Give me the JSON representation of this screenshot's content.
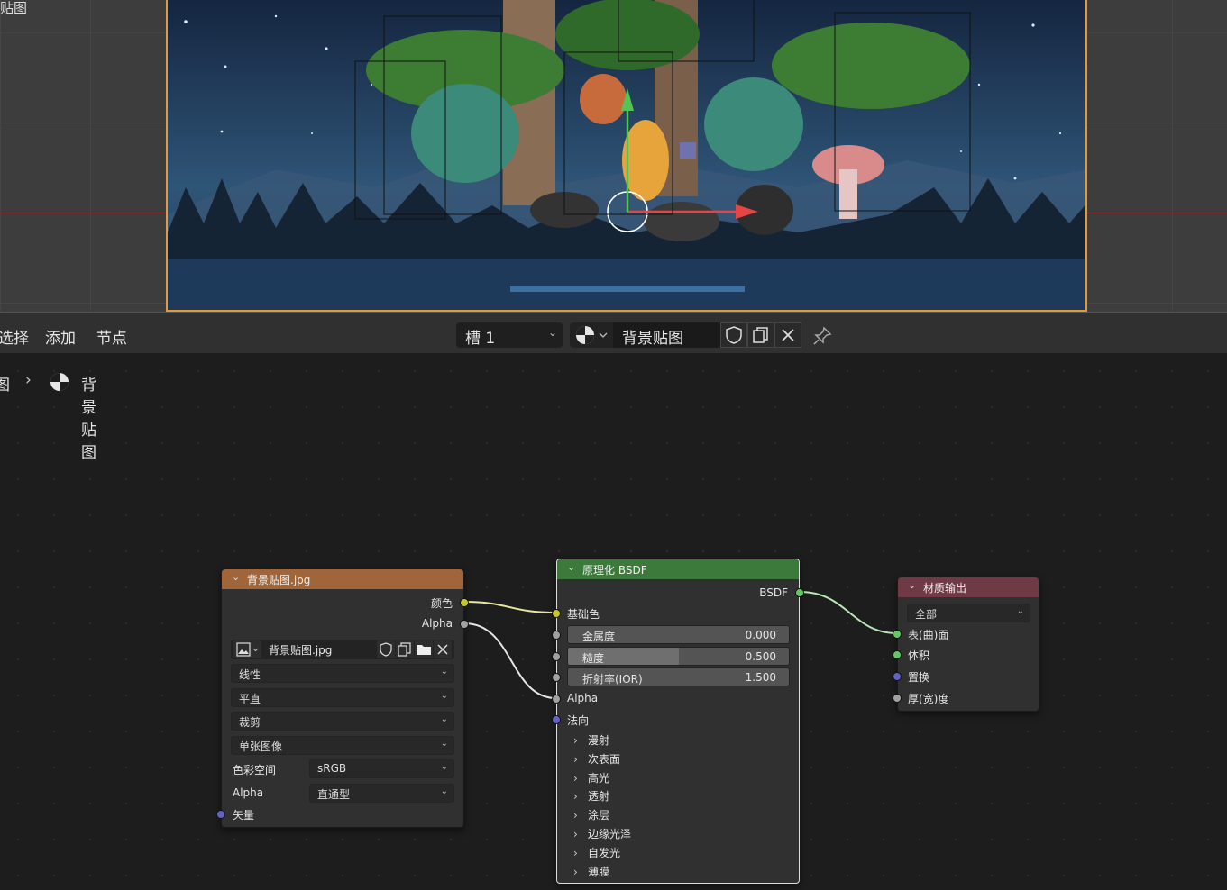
{
  "viewport": {
    "label": "贴图"
  },
  "header": {
    "menu": [
      "选择",
      "添加",
      "节点"
    ],
    "slot": "槽 1",
    "material_name": "背景贴图"
  },
  "breadcrumb": {
    "prev": "图",
    "separator": "›",
    "current": "背景贴图"
  },
  "image_node": {
    "title": "背景贴图.jpg",
    "outputs": [
      "颜色",
      "Alpha"
    ],
    "image_name": "背景贴图.jpg",
    "interpolation": "线性",
    "projection": "平直",
    "extension": "裁剪",
    "source": "单张图像",
    "colorspace_label": "色彩空间",
    "colorspace_value": "sRGB",
    "alpha_label": "Alpha",
    "alpha_value": "直通型",
    "vector_input": "矢量"
  },
  "bsdf_node": {
    "title": "原理化 BSDF",
    "output": "BSDF",
    "base_color": "基础色",
    "metallic": {
      "name": "金属度",
      "value": "0.000",
      "fraction": 0.0
    },
    "roughness": {
      "name": "糙度",
      "value": "0.500",
      "fraction": 0.5
    },
    "ior": {
      "name": "折射率(IOR)",
      "value": "1.500",
      "fraction": 0.0
    },
    "alpha": "Alpha",
    "normal": "法向",
    "panels": [
      "漫射",
      "次表面",
      "高光",
      "透射",
      "涂层",
      "边缘光泽",
      "自发光",
      "薄膜"
    ]
  },
  "output_node": {
    "title": "材质输出",
    "target": "全部",
    "inputs": [
      "表(曲)面",
      "体积",
      "置换",
      "厚(宽)度"
    ]
  },
  "colors": {
    "image_header": "#a0663a",
    "bsdf_header": "#3c7a3c",
    "output_header": "#6f3a46",
    "camera_border": "#e49a3c"
  }
}
